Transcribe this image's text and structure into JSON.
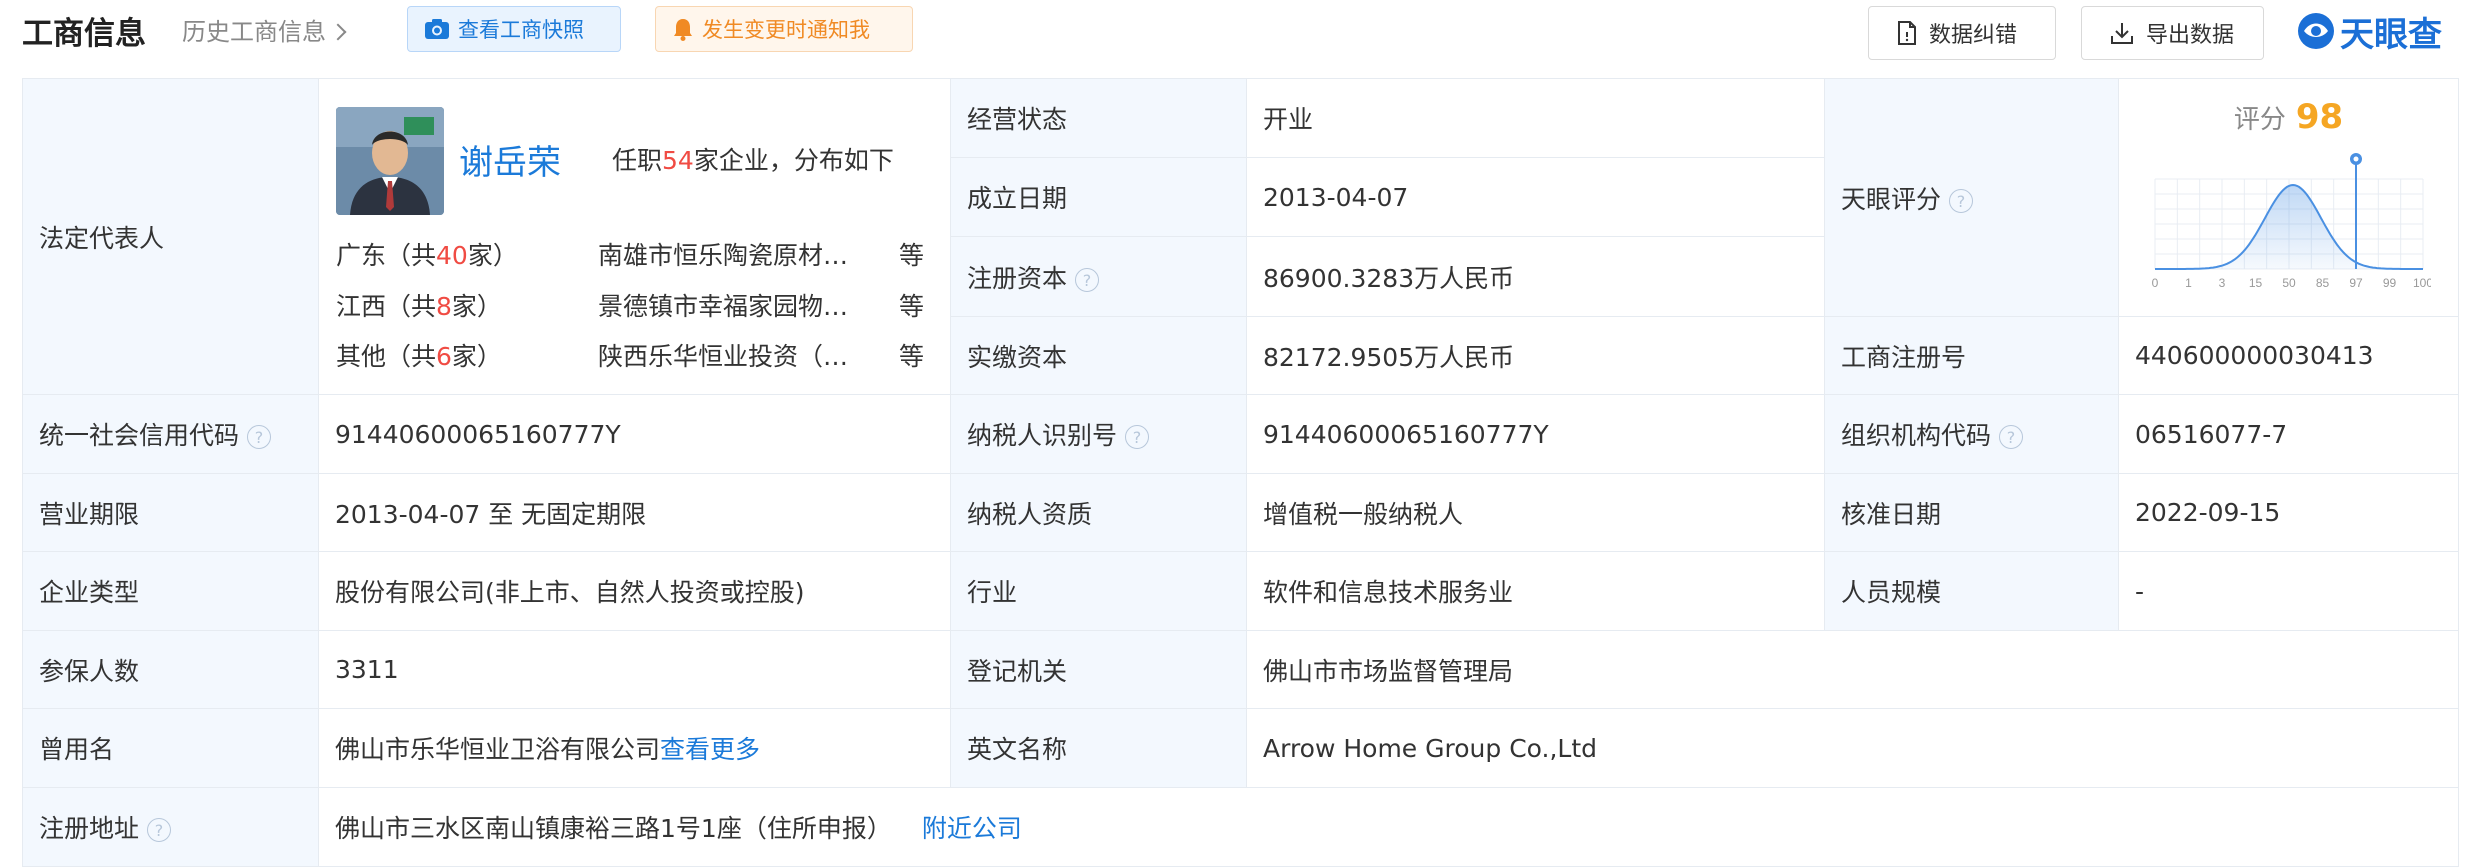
{
  "header": {
    "title": "工商信息",
    "history_link": "历史工商信息",
    "snapshot_button": "查看工商快照",
    "notify_button": "发生变更时通知我",
    "correct_button": "数据纠错",
    "export_button": "导出数据",
    "logo_text": "天眼查"
  },
  "legal_rep": {
    "label": "法定代表人",
    "name": "谢岳荣",
    "stat_prefix": "任职",
    "count": "54",
    "stat_suffix": "家企业，分布如下",
    "regions": [
      {
        "prefix": "广东（共",
        "count": "40",
        "suffix": "家）",
        "company": "南雄市恒乐陶瓷原材料有限公司",
        "etc": "等"
      },
      {
        "prefix": "江西（共",
        "count": "8",
        "suffix": "家）",
        "company": "景德镇市幸福家园物业管理有限公司",
        "etc": "等"
      },
      {
        "prefix": "其他（共",
        "count": "6",
        "suffix": "家）",
        "company": "陕西乐华恒业投资（集团）有限公司",
        "etc": "等"
      }
    ]
  },
  "fields": {
    "status_label": "经营状态",
    "status_value": "开业",
    "found_label": "成立日期",
    "found_value": "2013-04-07",
    "capital_label": "注册资本",
    "capital_value": "86900.3283万人民币",
    "paid_label": "实缴资本",
    "paid_value": "82172.9505万人民币",
    "score_label": "天眼评分",
    "reg_no_label": "工商注册号",
    "reg_no_value": "440600000030413",
    "credit_label": "统一社会信用代码",
    "credit_value": "91440600065160777Y",
    "taxid_label": "纳税人识别号",
    "taxid_value": "91440600065160777Y",
    "org_label": "组织机构代码",
    "org_value": "06516077-7",
    "term_label": "营业期限",
    "term_value": "2013-04-07 至 无固定期限",
    "taxq_label": "纳税人资质",
    "taxq_value": "增值税一般纳税人",
    "approve_label": "核准日期",
    "approve_value": "2022-09-15",
    "type_label": "企业类型",
    "type_value": "股份有限公司(非上市、自然人投资或控股)",
    "industry_label": "行业",
    "industry_value": "软件和信息技术服务业",
    "staff_label": "人员规模",
    "staff_value": "-",
    "insured_label": "参保人数",
    "insured_value": "3311",
    "authority_label": "登记机关",
    "authority_value": "佛山市市场监督管理局",
    "former_label": "曾用名",
    "former_value": "佛山市乐华恒业卫浴有限公司",
    "former_more": "查看更多",
    "english_label": "英文名称",
    "english_value": "Arrow Home Group Co.,Ltd",
    "address_label": "注册地址",
    "address_value": "佛山市三水区南山镇康裕三路1号1座（住所申报）",
    "address_nearby": "附近公司"
  },
  "score": {
    "title": "评分",
    "value": "98",
    "ticks": [
      "0",
      "1",
      "3",
      "15",
      "50",
      "85",
      "97",
      "99",
      "100"
    ],
    "marker_tick": "97",
    "curve_color": "#4a90e2"
  }
}
